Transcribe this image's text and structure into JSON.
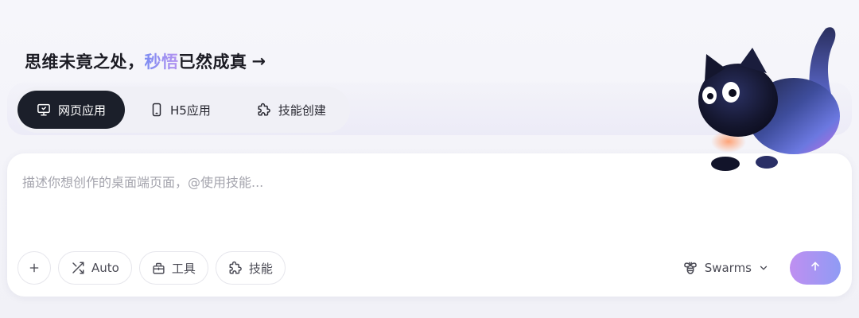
{
  "headline": {
    "before": "思维未竟之处，",
    "accent": "秒悟",
    "after": "已然成真",
    "arrow": "→"
  },
  "tabs": [
    {
      "label": "网页应用",
      "icon": "monitor-icon",
      "active": true
    },
    {
      "label": "H5应用",
      "icon": "phone-icon",
      "active": false
    },
    {
      "label": "技能创建",
      "icon": "puzzle-icon",
      "active": false
    }
  ],
  "composer": {
    "placeholder": "描述你想创作的桌面端页面，@使用技能...",
    "value": ""
  },
  "toolbar": {
    "add_label": "+",
    "auto_label": "Auto",
    "tools_label": "工具",
    "skills_label": "技能",
    "model_label": "Swarms"
  },
  "icons": {
    "add": "plus-icon",
    "auto": "shuffle-icon",
    "tools": "toolbox-icon",
    "skills": "puzzle-icon",
    "model": "bee-icon",
    "dropdown": "chevron-down-icon",
    "send": "arrow-up-icon",
    "mascot": "black-cat-mascot"
  },
  "colors": {
    "active_tab_bg": "#1b1f2a",
    "accent_from": "#7d8cf2",
    "accent_to": "#b593f0",
    "send_from": "#bf8ff1",
    "send_to": "#8f9bf4",
    "placeholder": "#a4a4ad"
  }
}
